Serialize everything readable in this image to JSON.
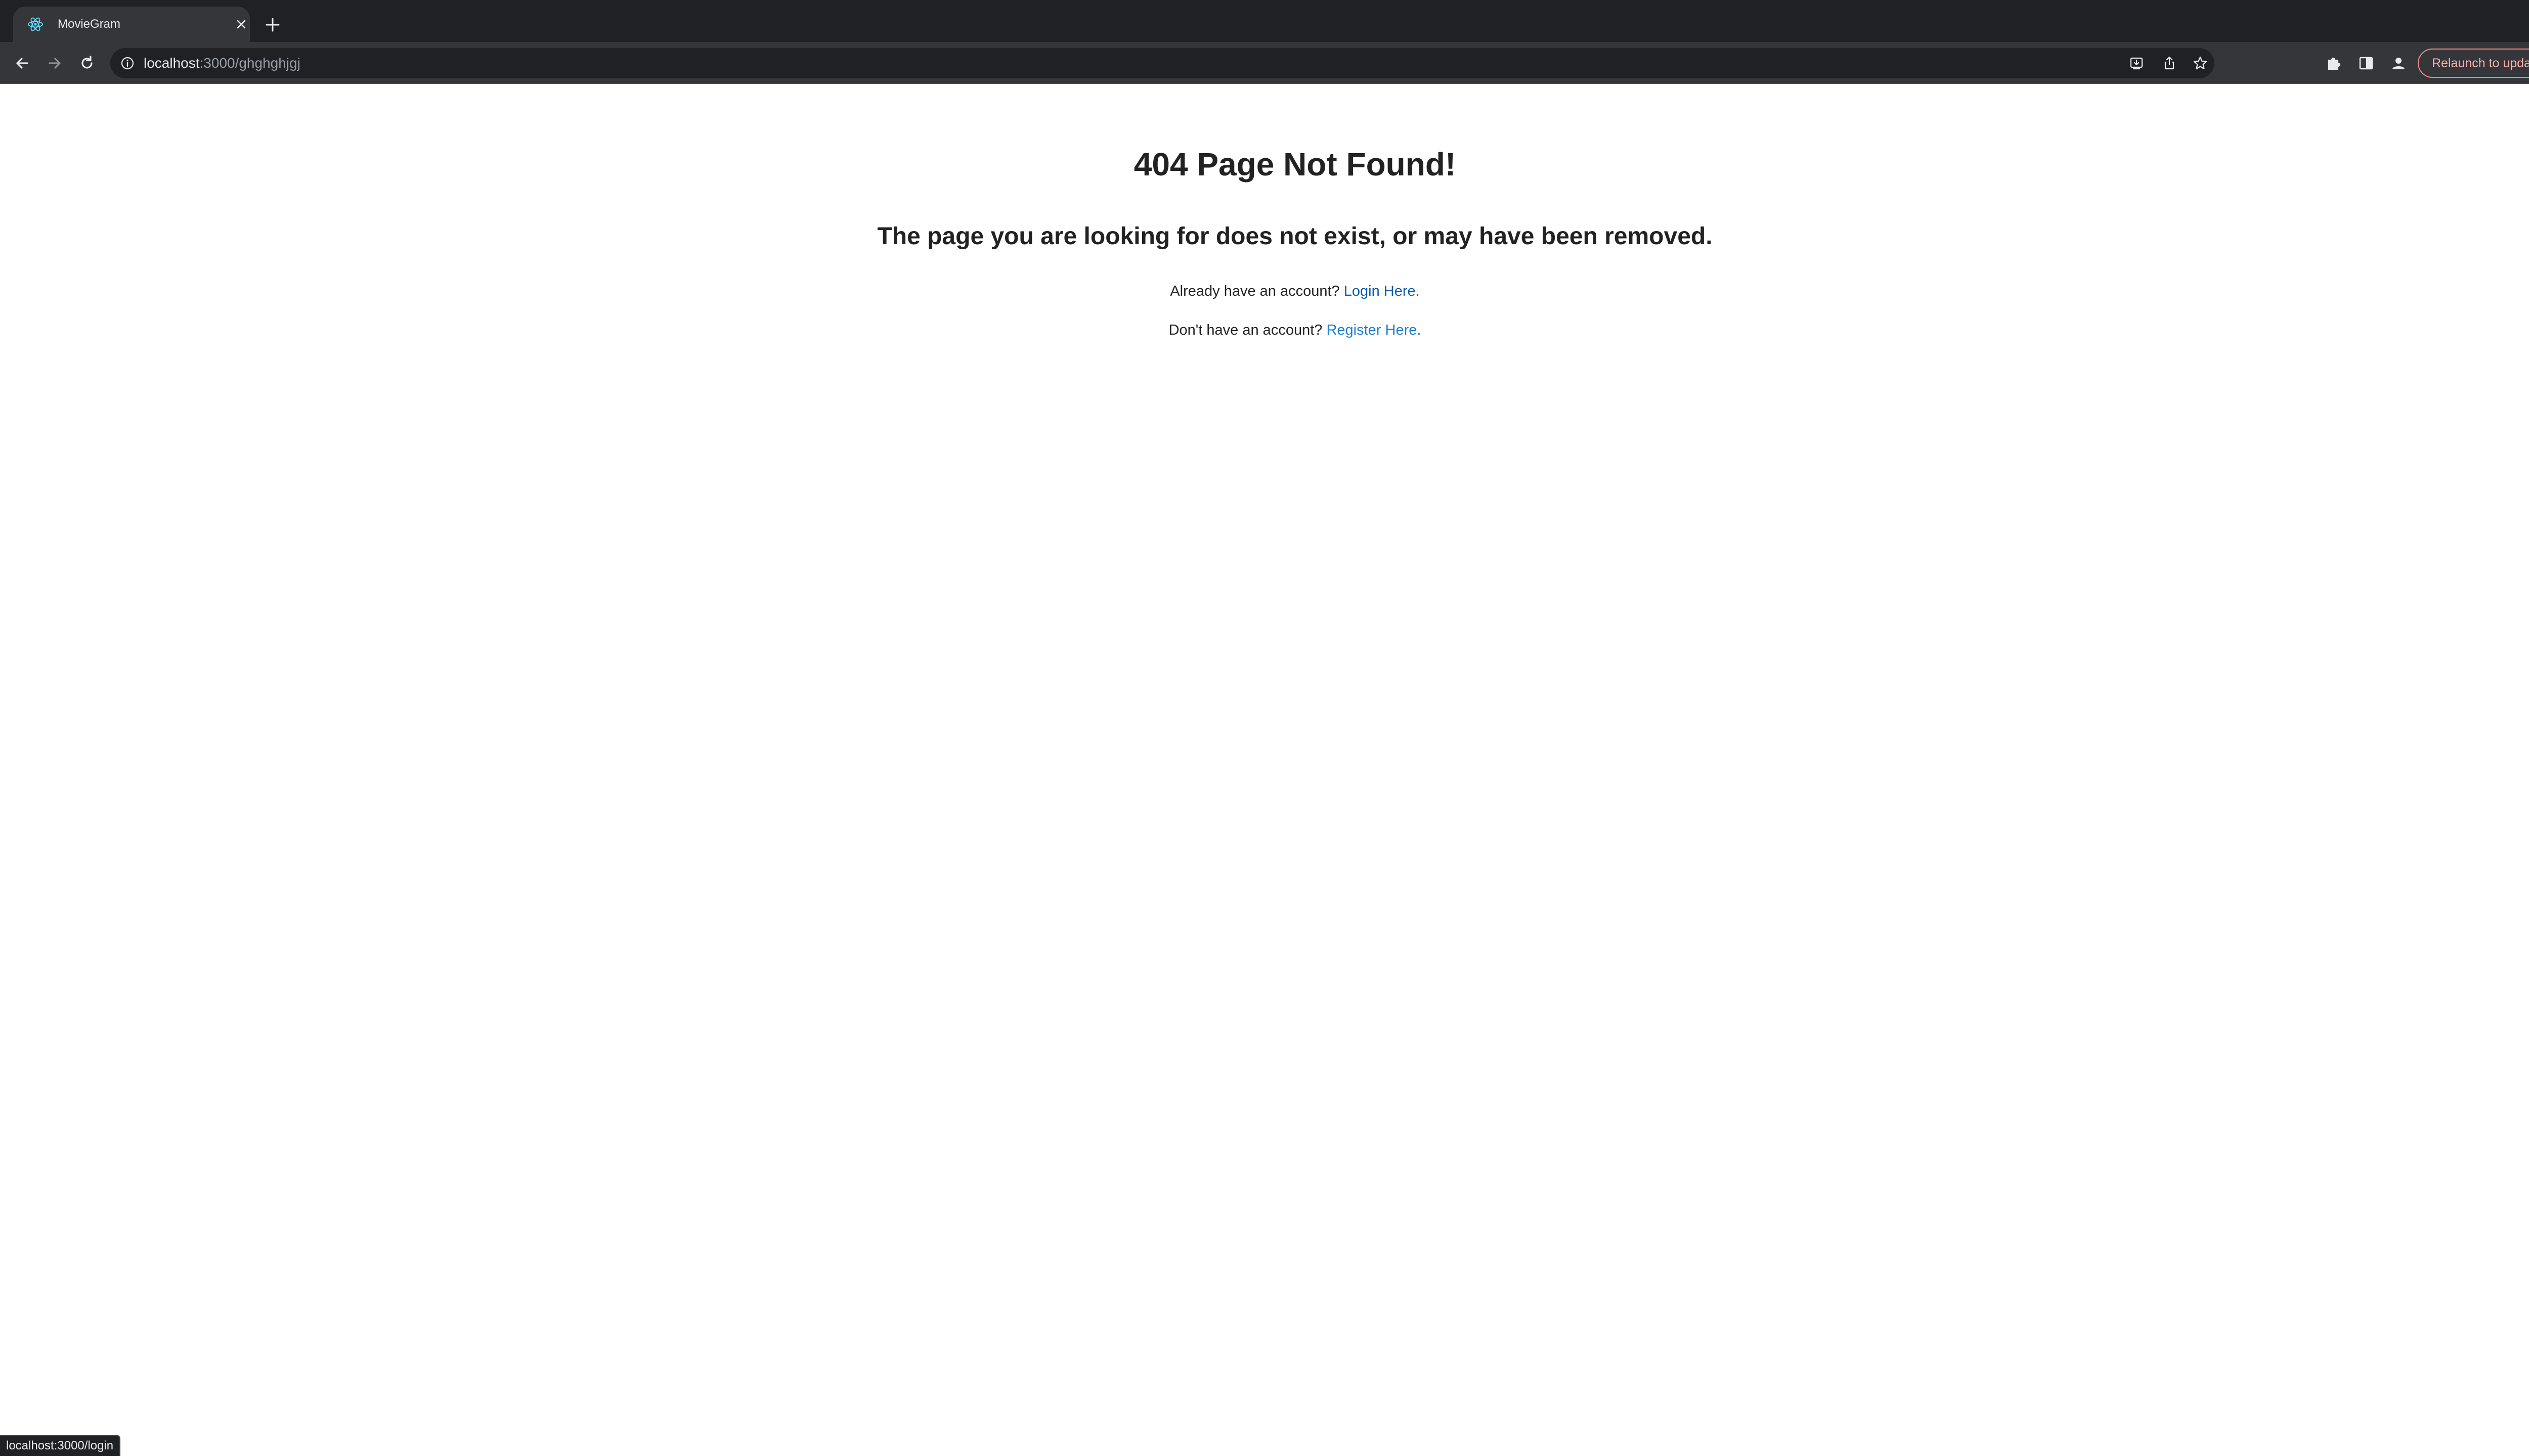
{
  "browser": {
    "tab": {
      "title": "MovieGram",
      "favicon_icon": "react-atom-icon"
    },
    "address_bar": {
      "host": "localhost",
      "path": ":3000/ghghghjgj"
    },
    "relaunch_label": "Relaunch to update",
    "status_bar_url": "localhost:3000/login",
    "colors": {
      "chrome_dark": "#202124",
      "chrome_toolbar": "#35363a",
      "relaunch_accent": "#f28b82"
    }
  },
  "page": {
    "heading": "404 Page Not Found!",
    "subheading": "The page you are looking for does not exist, or may have been removed.",
    "login_prompt": "Already have an account?",
    "login_link": "Login Here.",
    "register_prompt": "Don't have an account?",
    "register_link": "Register Here.",
    "colors": {
      "login_link": "#0b5cad",
      "register_link": "#1a7fd4"
    }
  }
}
